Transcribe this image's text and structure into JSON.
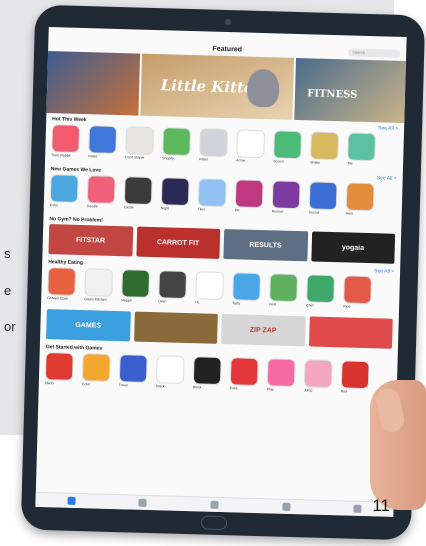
{
  "page": {
    "side_text": [
      "s",
      "e",
      "or"
    ],
    "page_number": "11"
  },
  "screen": {
    "nav_title": "Featured",
    "search_placeholder": "Search",
    "hero": [
      {
        "title": ""
      },
      {
        "title": "Little Kitten"
      },
      {
        "title": "FITNESS"
      }
    ],
    "sections": [
      {
        "title": "Hot This Week",
        "see_all": "See All >",
        "apps": [
          {
            "name": "Tonic Rabbit",
            "color": "#f25a6f"
          },
          {
            "name": "Notes",
            "color": "#3f78d9"
          },
          {
            "name": "Don't Starve",
            "color": "#e7e4df"
          },
          {
            "name": "Shopify",
            "color": "#5db85d"
          },
          {
            "name": "Kitten",
            "color": "#cfd5da"
          },
          {
            "name": "Arrow",
            "color": "#ffffff"
          },
          {
            "name": "Scorch",
            "color": "#4cbb78"
          },
          {
            "name": "Snake",
            "color": "#d8b85e"
          },
          {
            "name": "Tile",
            "color": "#5ac1a2"
          }
        ]
      },
      {
        "title": "New Games We Love",
        "see_all": "See All >",
        "apps": [
          {
            "name": "Color",
            "color": "#4aa7e0"
          },
          {
            "name": "Doodle",
            "color": "#f0607b"
          },
          {
            "name": "Castle",
            "color": "#3b3b3b"
          },
          {
            "name": "Night",
            "color": "#2a2a55"
          },
          {
            "name": "Tiles",
            "color": "#8fc2f2"
          },
          {
            "name": "PR",
            "color": "#c0397e"
          },
          {
            "name": "Runner",
            "color": "#7c3ba0"
          },
          {
            "name": "Soccer",
            "color": "#3c6fd6"
          },
          {
            "name": "Hero",
            "color": "#e28c3c"
          }
        ]
      },
      {
        "title": "No Gym? No Problem!",
        "see_all": "",
        "banners": [
          {
            "label": "FITSTAR",
            "color": "#c24641"
          },
          {
            "label": "CARROT FIT",
            "color": "#b9302c"
          },
          {
            "label": "RESULTS",
            "color": "#5f6f83"
          },
          {
            "label": "yogaia",
            "color": "#222222"
          }
        ]
      },
      {
        "title": "Healthy Eating",
        "see_all": "See All >",
        "apps": [
          {
            "name": "Fit Men Cook",
            "color": "#e8603e"
          },
          {
            "name": "Green Kitchen",
            "color": "#f0f0f0"
          },
          {
            "name": "Veggie",
            "color": "#2e6b2e"
          },
          {
            "name": "Oven",
            "color": "#444444"
          },
          {
            "name": "HL",
            "color": "#ffffff"
          },
          {
            "name": "Tasty",
            "color": "#4aa6e6"
          },
          {
            "name": "Fruit",
            "color": "#5fb05f"
          },
          {
            "name": "Chef",
            "color": "#3fa86b"
          },
          {
            "name": "Ripe",
            "color": "#e35a46"
          }
        ]
      },
      {
        "title": "",
        "see_all": "",
        "banners": [
          {
            "label": "GAMES",
            "color": "#3aa0e0"
          },
          {
            "label": "",
            "color": "#8a6a3a"
          },
          {
            "label": "ZIP ZAP",
            "color": "#d6d6d6"
          },
          {
            "label": "",
            "color": "#e04a4a"
          }
        ]
      },
      {
        "title": "Get Started with Games",
        "see_all": "",
        "apps": [
          {
            "name": "Mario",
            "color": "#e0392f"
          },
          {
            "name": "Color",
            "color": "#f4a72f"
          },
          {
            "name": "Tower",
            "color": "#3a5fcf"
          },
          {
            "name": "Stack",
            "color": "#ffffff"
          },
          {
            "name": "Block",
            "color": "#222222"
          },
          {
            "name": "Poke",
            "color": "#e4373a"
          },
          {
            "name": "Play",
            "color": "#f76aa1"
          },
          {
            "name": "Jump",
            "color": "#f3a7c0"
          },
          {
            "name": "Red",
            "color": "#d8332f"
          }
        ]
      }
    ]
  }
}
